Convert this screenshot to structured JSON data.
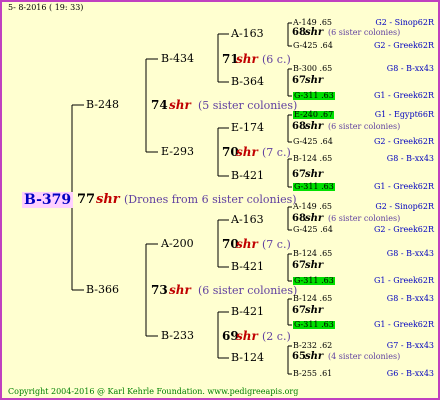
{
  "header": {
    "date": "5-  8-2016 ( 19: 33)"
  },
  "footer": {
    "copyright": "Copyright 2004-2016 @ Karl Kehrle Foundation.   www.pedigreeapis.org"
  },
  "root": {
    "id": "B-379",
    "qnum": "77",
    "shr": "shr",
    "note": "(Drones from 6 sister colonies)"
  },
  "gen1": [
    {
      "id": "B-248",
      "qnum": "74",
      "shr": "shr",
      "note": "(5 sister colonies)"
    },
    {
      "id": "B-366",
      "qnum": "73",
      "shr": "shr",
      "note": "(6 sister colonies)"
    }
  ],
  "gen2": [
    {
      "id": "B-434",
      "qnum": "71",
      "shr": "shr",
      "note": "(6 c.)"
    },
    {
      "id": "E-293",
      "qnum": "70",
      "shr": "shr",
      "note": "(7 c.)"
    },
    {
      "id": "A-200",
      "qnum": "70",
      "shr": "shr",
      "note": "(7 c.)"
    },
    {
      "id": "B-233",
      "qnum": "69",
      "shr": "shr",
      "note": "(2 c.)"
    }
  ],
  "gen3": [
    {
      "id": "A-163",
      "qnum": "68",
      "shr": "shr",
      "note": "(6 sister colonies)"
    },
    {
      "id": "B-364",
      "qnum": "67",
      "shr": "shr",
      "note": ""
    },
    {
      "id": "E-174",
      "qnum": "68",
      "shr": "shr",
      "note": "(6 sister colonies)"
    },
    {
      "id": "B-421",
      "qnum": "67",
      "shr": "shr",
      "note": ""
    },
    {
      "id": "A-163",
      "qnum": "68",
      "shr": "shr",
      "note": "(6 sister colonies)"
    },
    {
      "id": "B-421",
      "qnum": "67",
      "shr": "shr",
      "note": ""
    },
    {
      "id": "B-421",
      "qnum": "67",
      "shr": "shr",
      "note": ""
    },
    {
      "id": "B-124",
      "qnum": "65",
      "shr": "shr",
      "note": "(4 sister colonies)"
    }
  ],
  "leaves": [
    {
      "id": "A-149",
      "val": ".65",
      "green": false,
      "origin": "G2 - Sinop62R"
    },
    {
      "id": "G-425",
      "val": ".64",
      "green": false,
      "origin": "G2 - Greek62R"
    },
    {
      "id": "B-300",
      "val": ".65",
      "green": false,
      "origin": "G8 - B-xx43"
    },
    {
      "id": "G-311",
      "val": ".63",
      "green": true,
      "origin": "G1 - Greek62R"
    },
    {
      "id": "E-240",
      "val": ".67",
      "green": true,
      "origin": "G1 - Egypt66R"
    },
    {
      "id": "G-425",
      "val": ".64",
      "green": false,
      "origin": "G2 - Greek62R"
    },
    {
      "id": "B-124",
      "val": ".65",
      "green": false,
      "origin": "G8 - B-xx43"
    },
    {
      "id": "G-311",
      "val": ".63",
      "green": true,
      "origin": "G1 - Greek62R"
    },
    {
      "id": "A-149",
      "val": ".65",
      "green": false,
      "origin": "G2 - Sinop62R"
    },
    {
      "id": "G-425",
      "val": ".64",
      "green": false,
      "origin": "G2 - Greek62R"
    },
    {
      "id": "B-124",
      "val": ".65",
      "green": false,
      "origin": "G8 - B-xx43"
    },
    {
      "id": "G-311",
      "val": ".63",
      "green": true,
      "origin": "G1 - Greek62R"
    },
    {
      "id": "B-124",
      "val": ".65",
      "green": false,
      "origin": "G8 - B-xx43"
    },
    {
      "id": "G-311",
      "val": ".63",
      "green": true,
      "origin": "G1 - Greek62R"
    },
    {
      "id": "B-232",
      "val": ".62",
      "green": false,
      "origin": "G7 - B-xx43"
    },
    {
      "id": "B-255",
      "val": ".61",
      "green": false,
      "origin": "G6 - B-xx43"
    }
  ]
}
